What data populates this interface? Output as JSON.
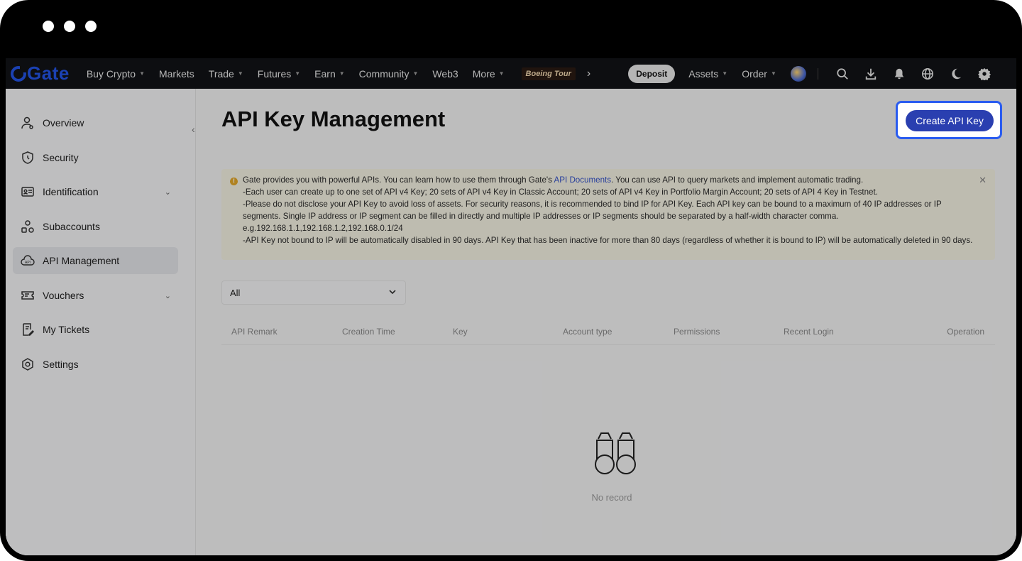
{
  "window": {
    "dots": 3
  },
  "nav": {
    "logo": "Gate",
    "items": [
      {
        "label": "Buy Crypto",
        "caret": true
      },
      {
        "label": "Markets",
        "caret": false
      },
      {
        "label": "Trade",
        "caret": true
      },
      {
        "label": "Futures",
        "caret": true
      },
      {
        "label": "Earn",
        "caret": true
      },
      {
        "label": "Community",
        "caret": true
      },
      {
        "label": "Web3",
        "caret": false
      },
      {
        "label": "More",
        "caret": true
      }
    ],
    "promo": "Boeing Tour",
    "deposit": "Deposit",
    "assets": "Assets",
    "order": "Order",
    "icons": [
      "search-icon",
      "download-icon",
      "bell-icon",
      "globe-icon",
      "moon-icon",
      "gear-icon"
    ]
  },
  "sidebar": {
    "items": [
      {
        "label": "Overview",
        "icon": "user-icon",
        "arrow": false,
        "active": false
      },
      {
        "label": "Security",
        "icon": "shield-icon",
        "arrow": false,
        "active": false
      },
      {
        "label": "Identification",
        "icon": "id-card-icon",
        "arrow": true,
        "active": false
      },
      {
        "label": "Subaccounts",
        "icon": "subaccounts-icon",
        "arrow": false,
        "active": false
      },
      {
        "label": "API Management",
        "icon": "api-cloud-icon",
        "arrow": false,
        "active": true
      },
      {
        "label": "Vouchers",
        "icon": "voucher-icon",
        "arrow": true,
        "active": false
      },
      {
        "label": "My Tickets",
        "icon": "ticket-icon",
        "arrow": false,
        "active": false
      },
      {
        "label": "Settings",
        "icon": "settings-icon",
        "arrow": false,
        "active": false
      }
    ]
  },
  "main": {
    "title": "API Key Management",
    "create_button": "Create API Key",
    "notice": {
      "line1_pre": "Gate provides you with powerful APIs. You can learn how to use them through Gate's ",
      "line1_link": "API Documents",
      "line1_post": ". You can use API to query markets and implement automatic trading.",
      "line2": "-Each user can create up to one set of API v4 Key; 20 sets of API v4 Key in Classic Account; 20 sets of API v4 Key in Portfolio Margin Account; 20 sets of API 4 Key in Testnet.",
      "line3": "-Please do not disclose your API Key to avoid loss of assets. For security reasons, it is recommended to bind IP for API Key. Each API key can be bound to a maximum of 40 IP addresses or IP segments. Single IP address or IP segment can be filled in directly and multiple IP addresses or IP segments should be separated by a half-width character comma.",
      "line4": "e.g.192.168.1.1,192.168.1.2,192.168.0.1/24",
      "line5": "-API Key not bound to IP will be automatically disabled in 90 days. API Key that has been inactive for more than 80 days (regardless of whether it is bound to IP) will be automatically deleted in 90 days."
    },
    "filter": {
      "value": "All"
    },
    "table_headers": [
      "API Remark",
      "Creation Time",
      "Key",
      "Account type",
      "Permissions",
      "Recent Login",
      "Operation"
    ],
    "empty_text": "No record"
  }
}
